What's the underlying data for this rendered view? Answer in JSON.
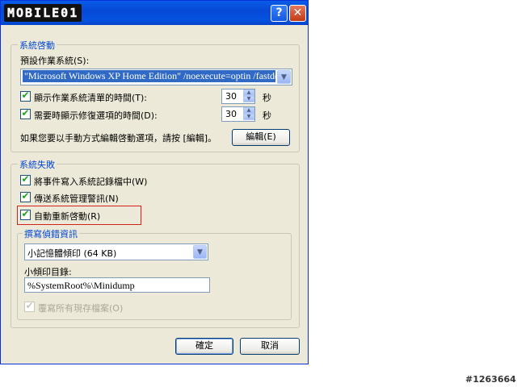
{
  "window": {
    "logo_text": "MOBILE01",
    "help_glyph": "?",
    "close_glyph": "✕"
  },
  "startup": {
    "group_title": "系統啓動",
    "default_os_label": "預設作業系統(S):",
    "default_os_value": "\"Microsoft Windows XP Home Edition\" /noexecute=optin /fastdete",
    "show_os_list_label": "顯示作業系統清單的時間(T):",
    "show_os_list_value": "30",
    "show_os_list_checked": true,
    "show_recovery_label": "需要時顯示修復選項的時間(D):",
    "show_recovery_value": "30",
    "show_recovery_checked": true,
    "unit": "秒",
    "edit_hint": "如果您要以手動方式編輯啓動選項，請按 [編輯]。",
    "edit_button": "編輯(E)"
  },
  "failure": {
    "group_title": "系統失敗",
    "write_event_label": "將事件寫入系統記錄檔中(W)",
    "write_event_checked": true,
    "send_alert_label": "傳送系統管理警訊(N)",
    "send_alert_checked": true,
    "auto_restart_label": "自動重新啓動(R)",
    "auto_restart_checked": true,
    "debug_group_title": "撰寫偵錯資訊",
    "debug_type_value": "小記憶體傾印 (64 KB)",
    "dump_dir_label": "小傾印目錄:",
    "dump_dir_value": "%SystemRoot%\\Minidump",
    "overwrite_label": "覆寫所有現存檔案(O)",
    "overwrite_checked": true
  },
  "footer": {
    "ok_button": "確定",
    "cancel_button": "取消"
  },
  "watermark": "#1263664",
  "colors": {
    "titlebar": "#0a5ce8",
    "group_title": "#0046d5",
    "highlight_box": "#d4211c",
    "selection": "#316ac5"
  }
}
